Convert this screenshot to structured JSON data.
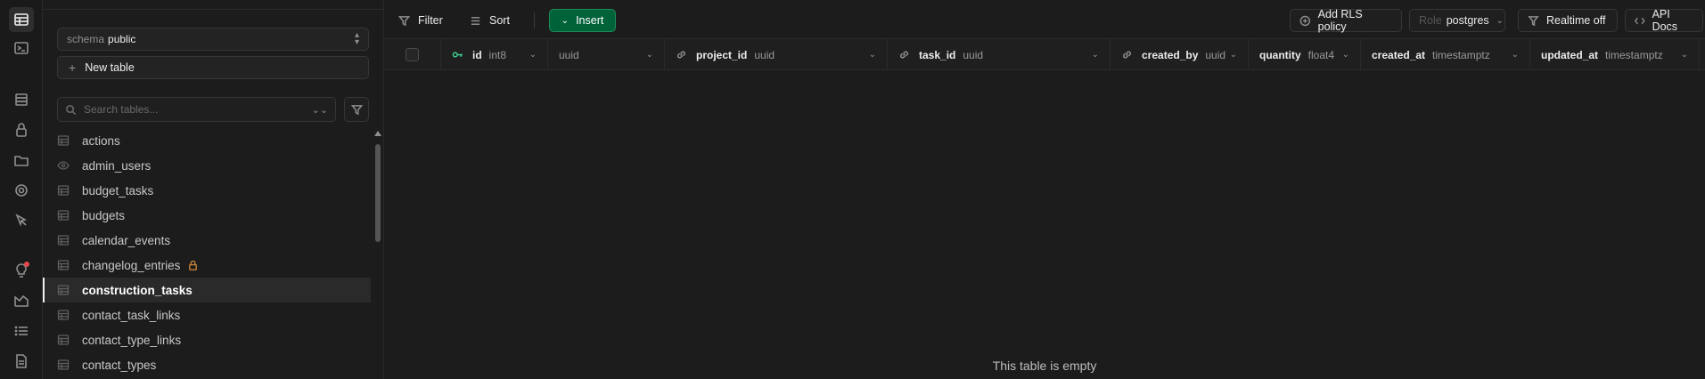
{
  "sidebar": {
    "schema_label": "schema",
    "schema_value": "public",
    "new_table_label": "New table",
    "search_placeholder": "Search tables...",
    "tables": [
      {
        "name": "actions",
        "icon": "table-icon"
      },
      {
        "name": "admin_users",
        "icon": "eye-icon"
      },
      {
        "name": "budget_tasks",
        "icon": "table-icon"
      },
      {
        "name": "budgets",
        "icon": "table-icon"
      },
      {
        "name": "calendar_events",
        "icon": "table-icon"
      },
      {
        "name": "changelog_entries",
        "icon": "table-icon",
        "locked": true
      },
      {
        "name": "construction_tasks",
        "icon": "table-icon",
        "active": true
      },
      {
        "name": "contact_task_links",
        "icon": "table-icon"
      },
      {
        "name": "contact_type_links",
        "icon": "table-icon"
      },
      {
        "name": "contact_types",
        "icon": "table-icon"
      }
    ]
  },
  "toolbar": {
    "filter_label": "Filter",
    "sort_label": "Sort",
    "insert_label": "Insert",
    "add_rls_label": "Add RLS policy",
    "role_label": "Role",
    "role_value": "postgres",
    "realtime_label": "Realtime off",
    "api_docs_label": "API Docs"
  },
  "columns": [
    {
      "name": "id",
      "type": "int8",
      "key": true
    },
    {
      "name": "",
      "type": "uuid"
    },
    {
      "name": "project_id",
      "type": "uuid",
      "link": true
    },
    {
      "name": "task_id",
      "type": "uuid",
      "link": true
    },
    {
      "name": "created_by",
      "type": "uuid",
      "link": true
    },
    {
      "name": "quantity",
      "type": "float4"
    },
    {
      "name": "created_at",
      "type": "timestamptz"
    },
    {
      "name": "updated_at",
      "type": "timestamptz"
    }
  ],
  "empty_message": "This table is empty",
  "colors": {
    "accent_green": "#006239",
    "key_green": "#3ecf8e",
    "lock_orange": "#c8823a",
    "notification_red": "#e5484d"
  }
}
